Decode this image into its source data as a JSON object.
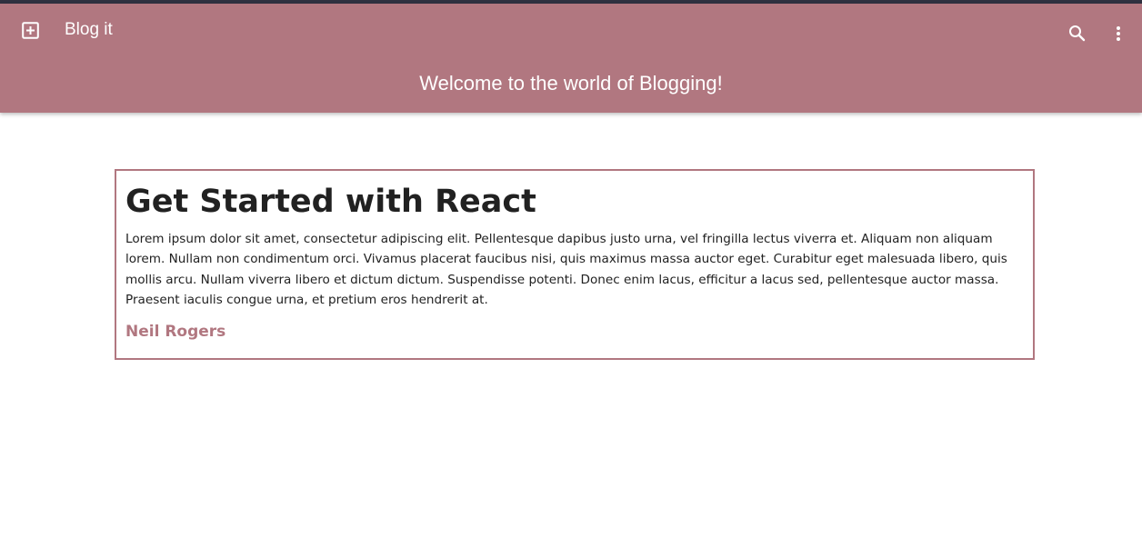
{
  "appbar": {
    "title": "Blog it",
    "banner": "Welcome to the world of Blogging!",
    "background_color": "#b17780",
    "icons": {
      "left": "add-box-icon",
      "right": [
        "search-icon",
        "more-vertical-icon"
      ]
    }
  },
  "post": {
    "title": "Get Started with React",
    "body": "Lorem ipsum dolor sit amet, consectetur adipiscing elit. Pellentesque dapibus justo urna, vel fringilla lectus viverra et. Aliquam non aliquam lorem. Nullam non condimentum orci. Vivamus placerat faucibus nisi, quis maximus massa auctor eget. Curabitur eget malesuada libero, quis mollis arcu. Nullam viverra libero et dictum dictum. Suspendisse potenti. Donec enim lacus, efficitur a lacus sed, pellentesque auctor massa. Praesent iaculis congue urna, et pretium eros hendrerit at.",
    "author": "Neil Rogers",
    "accent_color": "#b17780"
  }
}
